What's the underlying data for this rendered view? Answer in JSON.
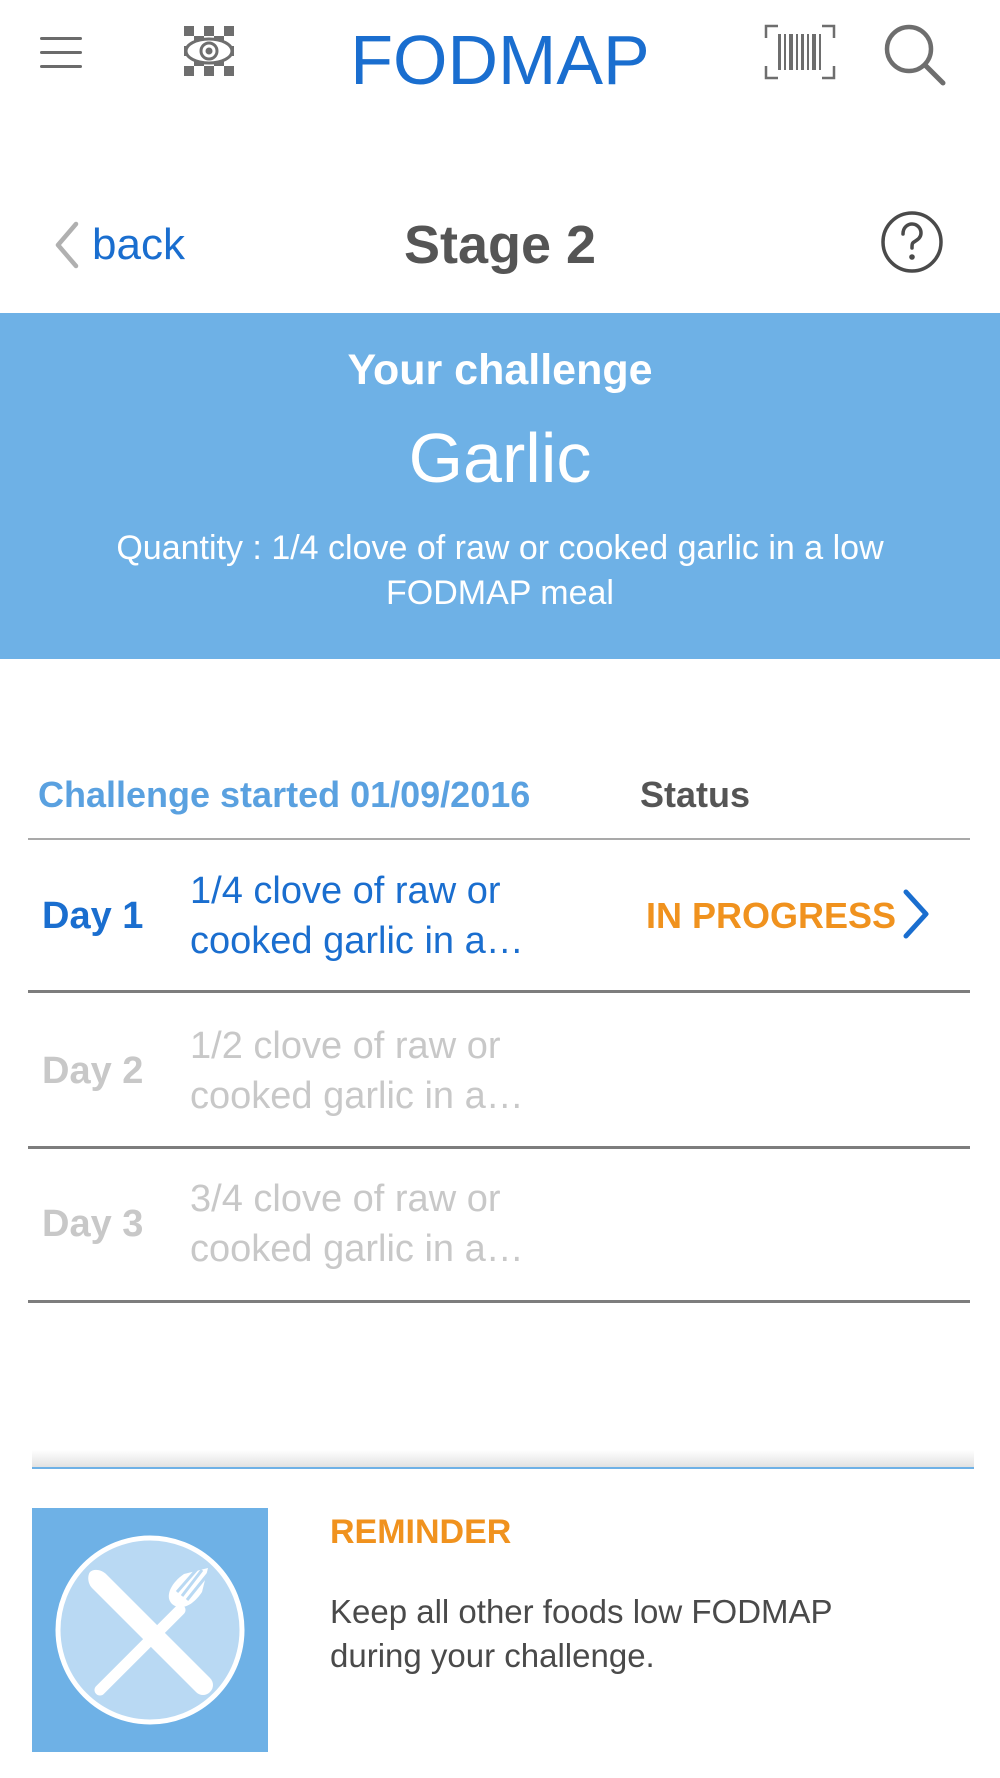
{
  "colors": {
    "brand_blue": "#1a6ecf",
    "banner_blue": "#6eb1e6",
    "text_dark": "#555555",
    "header_blue": "#5aa1e0",
    "muted": "#c8c8c8",
    "orange": "#f0921e"
  },
  "topbar": {
    "title": "FODMAP",
    "icons": [
      "hamburger-menu-icon",
      "eye-icon",
      "barcode-scan-icon",
      "search-icon"
    ]
  },
  "nav": {
    "back_label": "back",
    "stage_title": "Stage 2",
    "help_icon": "question-circle-icon"
  },
  "banner": {
    "heading": "Your challenge",
    "food": "Garlic",
    "quantity": "Quantity : 1/4 clove of raw or cooked garlic in a low FODMAP meal"
  },
  "table": {
    "started_label": "Challenge started 01/09/2016",
    "status_header": "Status",
    "rows": [
      {
        "day": "Day 1",
        "desc_line1": "1/4 clove of raw or",
        "desc_line2": "cooked garlic in a…",
        "status": "IN PROGRESS"
      },
      {
        "day": "Day 2",
        "desc_line1": "1/2 clove of raw or",
        "desc_line2": "cooked garlic in a…",
        "status": ""
      },
      {
        "day": "Day 3",
        "desc_line1": "3/4 clove of raw or",
        "desc_line2": "cooked garlic in a…",
        "status": ""
      }
    ]
  },
  "reminder": {
    "title": "REMINDER",
    "text": "Keep all other foods low FODMAP during your challenge.",
    "icon": "knife-fork-icon"
  }
}
